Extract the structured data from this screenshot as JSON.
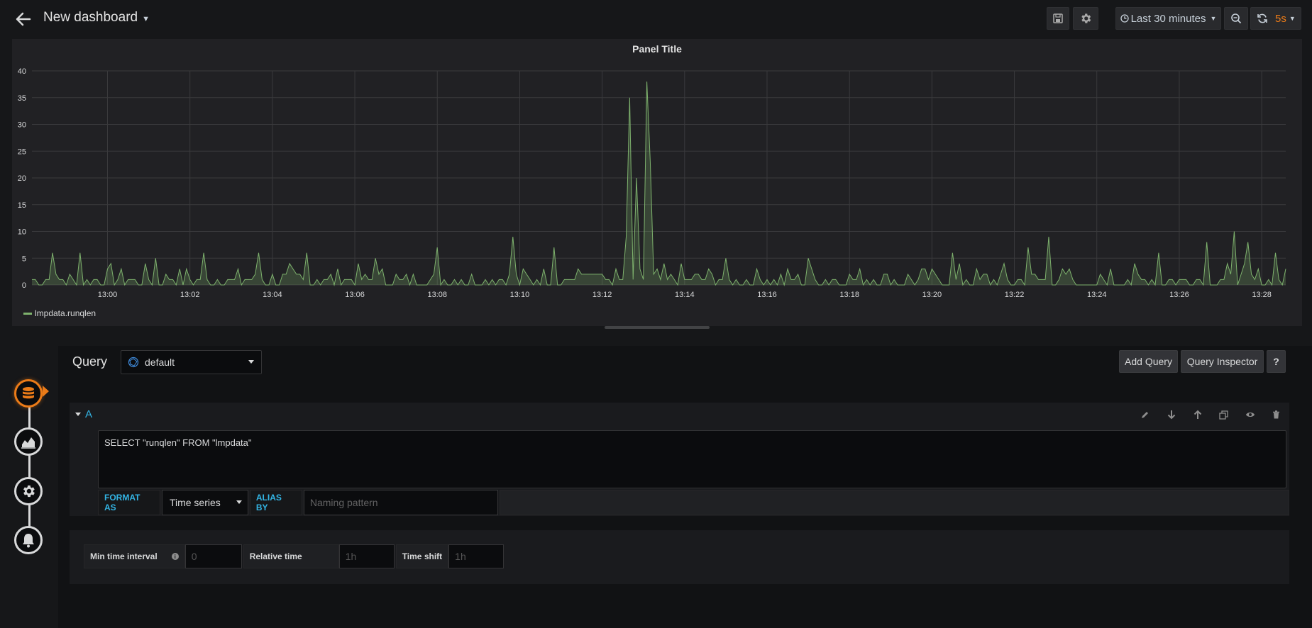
{
  "header": {
    "title": "New dashboard",
    "time_range": "Last 30 minutes",
    "refresh_interval": "5s"
  },
  "panel": {
    "title": "Panel Title",
    "legend": [
      "lmpdata.runqlen"
    ]
  },
  "chart_data": {
    "type": "line",
    "title": "Panel Title",
    "x_ticks": [
      "13:00",
      "13:02",
      "13:04",
      "13:06",
      "13:08",
      "13:10",
      "13:12",
      "13:14",
      "13:16",
      "13:18",
      "13:20",
      "13:22",
      "13:24",
      "13:26",
      "13:28"
    ],
    "y_ticks": [
      0,
      5,
      10,
      15,
      20,
      25,
      30,
      35,
      40
    ],
    "ylim": [
      0,
      40
    ],
    "xlim_minutes": [
      "12:58:10",
      "13:28:35"
    ],
    "grid": true,
    "legend_position": "bottom-left",
    "series": [
      {
        "name": "lmpdata.runqlen",
        "color": "#7eb26d",
        "baseline": 1,
        "typical_max": 5,
        "spikes": [
          {
            "t": "12:58:40",
            "v": 6
          },
          {
            "t": "12:59:20",
            "v": 6
          },
          {
            "t": "13:01:10",
            "v": 5
          },
          {
            "t": "13:02:20",
            "v": 6
          },
          {
            "t": "13:03:40",
            "v": 6
          },
          {
            "t": "13:04:50",
            "v": 6
          },
          {
            "t": "13:06:30",
            "v": 5
          },
          {
            "t": "13:08:00",
            "v": 7
          },
          {
            "t": "13:09:50",
            "v": 9
          },
          {
            "t": "13:10:50",
            "v": 7
          },
          {
            "t": "13:11:30",
            "v": 7
          },
          {
            "t": "13:12:35",
            "v": 9
          },
          {
            "t": "13:12:40",
            "v": 35
          },
          {
            "t": "13:12:50",
            "v": 20
          },
          {
            "t": "13:13:05",
            "v": 38
          },
          {
            "t": "13:13:10",
            "v": 23
          },
          {
            "t": "13:15:00",
            "v": 5
          },
          {
            "t": "13:17:00",
            "v": 5
          },
          {
            "t": "13:20:30",
            "v": 6
          },
          {
            "t": "13:22:20",
            "v": 7
          },
          {
            "t": "13:22:50",
            "v": 9
          },
          {
            "t": "13:23:40",
            "v": 5
          },
          {
            "t": "13:25:30",
            "v": 6
          },
          {
            "t": "13:26:40",
            "v": 8
          },
          {
            "t": "13:27:20",
            "v": 10
          },
          {
            "t": "13:27:40",
            "v": 8
          },
          {
            "t": "13:28:20",
            "v": 6
          }
        ],
        "flat_segments": [
          {
            "from": "13:11:30",
            "to": "13:12:00",
            "v": 2
          },
          {
            "from": "13:23:30",
            "to": "13:24:00",
            "v": 0
          }
        ]
      }
    ]
  },
  "editor": {
    "query_label": "Query",
    "datasource": "default",
    "add_query": "Add Query",
    "query_inspector": "Query Inspector",
    "help": "?",
    "query": {
      "ref_id": "A",
      "text": "SELECT \"runqlen\" FROM \"lmpdata\"",
      "format_as_label": "FORMAT AS",
      "format_as_value": "Time series",
      "alias_by_label": "ALIAS BY",
      "alias_placeholder": "Naming pattern"
    },
    "options": {
      "min_interval_label": "Min time interval",
      "min_interval_placeholder": "0",
      "relative_time_label": "Relative time",
      "relative_time_placeholder": "1h",
      "time_shift_label": "Time shift",
      "time_shift_placeholder": "1h"
    }
  },
  "sidebar": {
    "steps": [
      {
        "icon": "database-icon",
        "active": true
      },
      {
        "icon": "visualization-icon",
        "active": false
      },
      {
        "icon": "general-settings-icon",
        "active": false
      },
      {
        "icon": "alert-bell-icon",
        "active": false
      }
    ]
  }
}
